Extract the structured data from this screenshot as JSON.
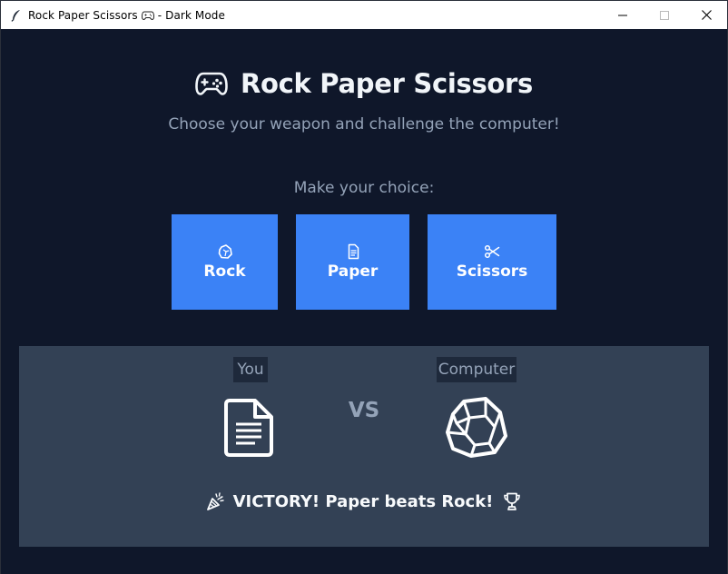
{
  "window": {
    "title": "Rock Paper Scissors",
    "title_suffix": "- Dark Mode",
    "title_icon": "gamepad-icon",
    "app_icon": "feather-icon"
  },
  "header": {
    "title": "Rock Paper Scissors",
    "icon": "gamepad-icon",
    "subtitle": "Choose your weapon and challenge the computer!"
  },
  "choices": {
    "prompt": "Make your choice:",
    "buttons": [
      {
        "label": "Rock",
        "icon": "rock-icon"
      },
      {
        "label": "Paper",
        "icon": "paper-icon"
      },
      {
        "label": "Scissors",
        "icon": "scissors-icon"
      }
    ]
  },
  "result": {
    "you_label": "You",
    "computer_label": "Computer",
    "you_choice_icon": "paper-icon",
    "computer_choice_icon": "rock-icon",
    "vs_text": "VS",
    "message": "VICTORY! Paper beats Rock!",
    "message_icons": [
      "party-popper-icon",
      "trophy-icon"
    ]
  },
  "colors": {
    "background": "#0f172a",
    "button": "#3b82f6",
    "panel": "#334155",
    "label_bg": "#1e293b",
    "muted_text": "#94a3b8",
    "text": "#f1f5f9"
  }
}
